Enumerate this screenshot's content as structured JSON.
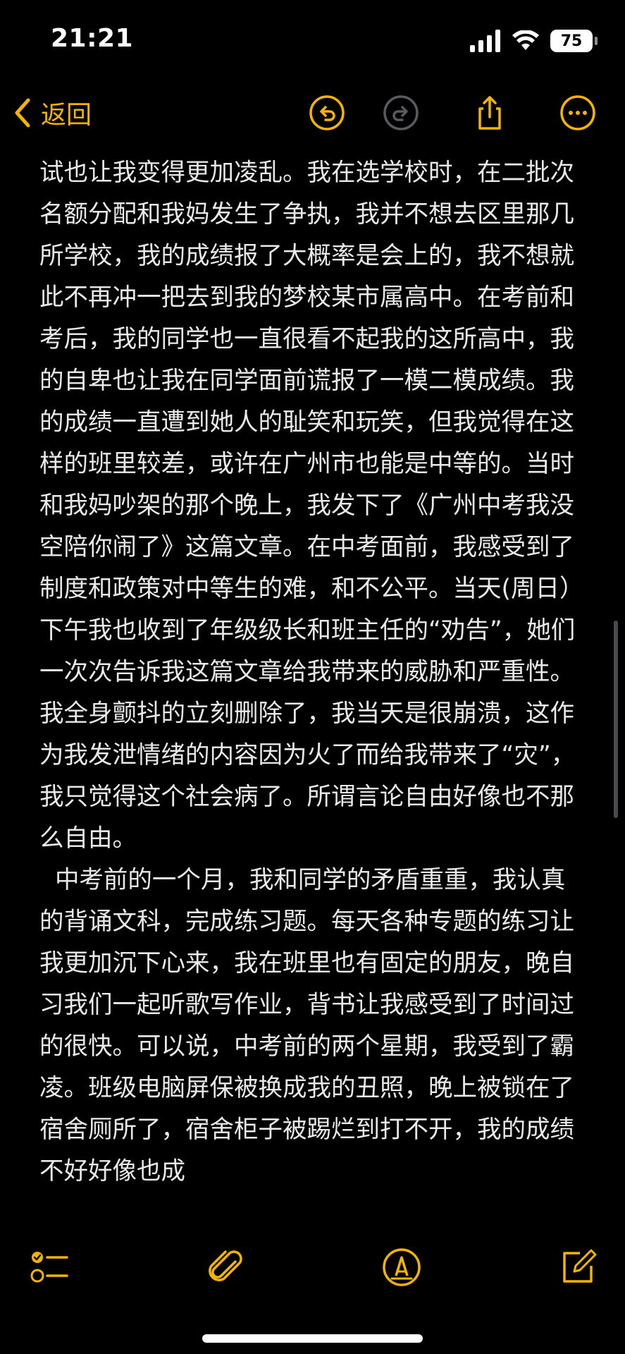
{
  "status_bar": {
    "time": "21:21",
    "battery_level": "75",
    "icons": [
      "signal-icon",
      "wifi-icon",
      "battery-icon"
    ]
  },
  "nav": {
    "back_label": "返回",
    "buttons": [
      "undo-icon",
      "redo-icon",
      "share-icon",
      "more-icon"
    ]
  },
  "note": {
    "body": "试也让我变得更加凌乱。我在选学校时，在二批次名额分配和我妈发生了争执，我并不想去区里那几所学校，我的成绩报了大概率是会上的，我不想就此不再冲一把去到我的梦校某市属高中。在考前和考后，我的同学也一直很看不起我的这所高中，我的自卑也让我在同学面前谎报了一模二模成绩。我的成绩一直遭到她人的耻笑和玩笑，但我觉得在这样的班里较差，或许在广州市也能是中等的。当时和我妈吵架的那个晚上，我发下了《广州中考我没空陪你闹了》这篇文章。在中考面前，我感受到了制度和政策对中等生的难，和不公平。当天(周日）下午我也收到了年级级长和班主任的“劝告”，她们一次次告诉我这篇文章给我带来的威胁和严重性。我全身颤抖的立刻删除了，我当天是很崩溃，这作为我发泄情绪的内容因为火了而给我带来了“灾”，我只觉得这个社会病了。所谓言论自由好像也不那么自由。\n  中考前的一个月，我和同学的矛盾重重，我认真的背诵文科，完成练习题。每天各种专题的练习让我更加沉下心来，我在班里也有固定的朋友，晚自习我们一起听歌写作业，背书让我感受到了时间过的很快。可以说，中考前的两个星期，我受到了霸凌。班级电脑屏保被换成我的丑照，晚上被锁在了宿舍厕所了，宿舍柜子被踢烂到打不开，我的成绩不好好像也成"
  },
  "bottom_toolbar": {
    "buttons": [
      "checklist-icon",
      "paperclip-icon",
      "markup-pen-icon",
      "compose-icon"
    ]
  },
  "colors": {
    "accent": "#f4b400",
    "text": "#e9e9ea",
    "background": "#000000",
    "disabled": "#5a5a5e"
  }
}
